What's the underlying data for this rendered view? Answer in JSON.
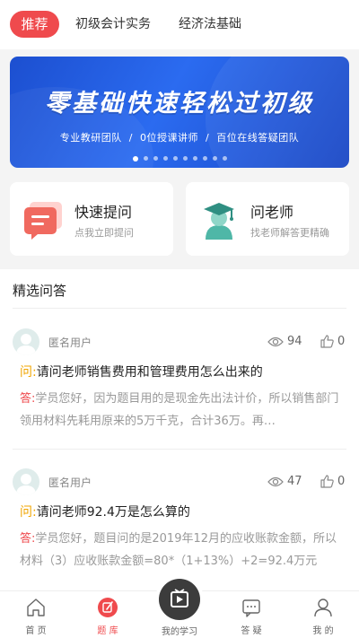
{
  "tabs": [
    {
      "label": "推荐"
    },
    {
      "label": "初级会计实务"
    },
    {
      "label": "经济法基础"
    }
  ],
  "banner": {
    "title": "零基础快速轻松过初级",
    "sub": [
      "专业教研团队",
      "0位授课讲师",
      "百位在线答疑团队"
    ],
    "separator": "/",
    "dots_total": 10,
    "dots_active_index": 0
  },
  "cards": [
    {
      "title": "快速提问",
      "subtitle": "点我立即提问",
      "icon": "question-chat-icon"
    },
    {
      "title": "问老师",
      "subtitle": "找老师解答更精确",
      "icon": "teacher-icon"
    }
  ],
  "section": {
    "title": "精选问答"
  },
  "qa": [
    {
      "user": "匿名用户",
      "views": "94",
      "likes": "0",
      "q_mark": "问:",
      "question": "请问老师销售费用和管理费用怎么出来的",
      "a_mark": "答:",
      "answer": "学员您好，因为题目用的是现金先出法计价，所以销售部门领用材料先耗用原来的5万千克，合计36万。再…"
    },
    {
      "user": "匿名用户",
      "views": "47",
      "likes": "0",
      "q_mark": "问:",
      "question": "请问老师92.4万是怎么算的",
      "a_mark": "答:",
      "answer": "学员您好，题目问的是2019年12月的应收账款金额，所以材料（3）应收账款金额=80*（1+13%）+2=92.4万元"
    }
  ],
  "nav": [
    {
      "label": "首 页",
      "icon": "home-icon"
    },
    {
      "label": "题 库",
      "icon": "question-bank-icon"
    },
    {
      "label": "我的学习",
      "icon": "play-icon"
    },
    {
      "label": "答 疑",
      "icon": "chat-icon"
    },
    {
      "label": "我 的",
      "icon": "user-icon"
    }
  ],
  "colors": {
    "accent": "#ef4a4d",
    "question_mark": "#f0a500",
    "banner": "#2b6bf0"
  }
}
